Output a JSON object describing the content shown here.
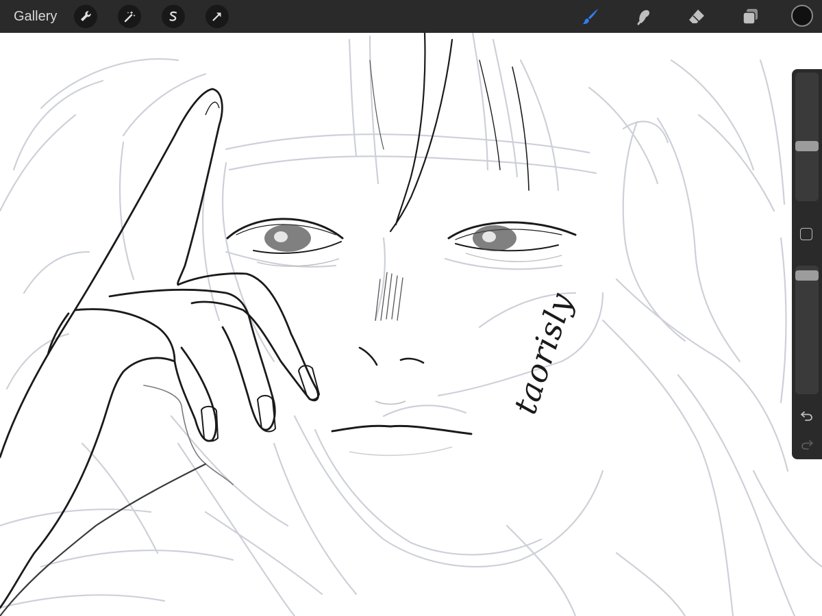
{
  "toolbar": {
    "gallery_label": "Gallery",
    "left_tools": [
      {
        "icon": "wrench-icon",
        "name": "actions"
      },
      {
        "icon": "magic-wand-icon",
        "name": "adjustments"
      },
      {
        "icon": "selection-icon",
        "name": "selection"
      },
      {
        "icon": "transform-arrow-icon",
        "name": "transform"
      }
    ],
    "right_tools": [
      {
        "icon": "brush-icon",
        "name": "paint",
        "active": true
      },
      {
        "icon": "smudge-icon",
        "name": "smudge",
        "active": false
      },
      {
        "icon": "eraser-icon",
        "name": "erase",
        "active": false
      },
      {
        "icon": "layers-icon",
        "name": "layers",
        "active": false
      }
    ],
    "current_color": "#111111",
    "active_color": "#2f7ef5"
  },
  "sidebar": {
    "brush_size_level": 0.42,
    "opacity_level": 0.96,
    "undo_icon": "undo-icon",
    "redo_icon": "redo-icon"
  },
  "canvas": {
    "sketch_color": "#c8ccd4",
    "ink_color": "#1a1a1a",
    "signature": "taorisly"
  }
}
